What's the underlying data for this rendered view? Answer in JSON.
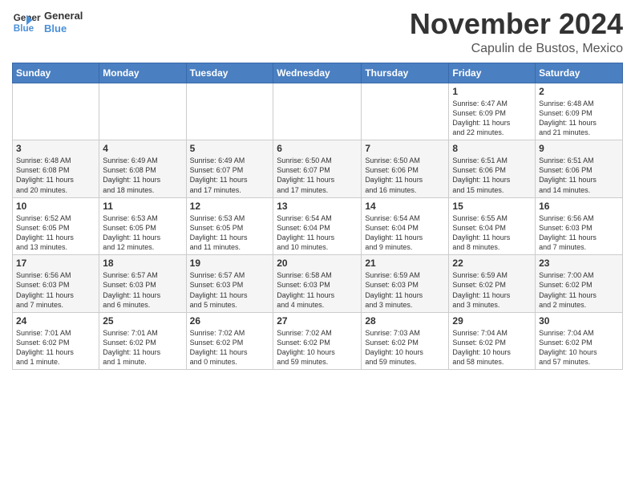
{
  "header": {
    "logo_line1": "General",
    "logo_line2": "Blue",
    "month": "November 2024",
    "location": "Capulin de Bustos, Mexico"
  },
  "weekdays": [
    "Sunday",
    "Monday",
    "Tuesday",
    "Wednesday",
    "Thursday",
    "Friday",
    "Saturday"
  ],
  "weeks": [
    [
      {
        "day": "",
        "info": ""
      },
      {
        "day": "",
        "info": ""
      },
      {
        "day": "",
        "info": ""
      },
      {
        "day": "",
        "info": ""
      },
      {
        "day": "",
        "info": ""
      },
      {
        "day": "1",
        "info": "Sunrise: 6:47 AM\nSunset: 6:09 PM\nDaylight: 11 hours\nand 22 minutes."
      },
      {
        "day": "2",
        "info": "Sunrise: 6:48 AM\nSunset: 6:09 PM\nDaylight: 11 hours\nand 21 minutes."
      }
    ],
    [
      {
        "day": "3",
        "info": "Sunrise: 6:48 AM\nSunset: 6:08 PM\nDaylight: 11 hours\nand 20 minutes."
      },
      {
        "day": "4",
        "info": "Sunrise: 6:49 AM\nSunset: 6:08 PM\nDaylight: 11 hours\nand 18 minutes."
      },
      {
        "day": "5",
        "info": "Sunrise: 6:49 AM\nSunset: 6:07 PM\nDaylight: 11 hours\nand 17 minutes."
      },
      {
        "day": "6",
        "info": "Sunrise: 6:50 AM\nSunset: 6:07 PM\nDaylight: 11 hours\nand 17 minutes."
      },
      {
        "day": "7",
        "info": "Sunrise: 6:50 AM\nSunset: 6:06 PM\nDaylight: 11 hours\nand 16 minutes."
      },
      {
        "day": "8",
        "info": "Sunrise: 6:51 AM\nSunset: 6:06 PM\nDaylight: 11 hours\nand 15 minutes."
      },
      {
        "day": "9",
        "info": "Sunrise: 6:51 AM\nSunset: 6:06 PM\nDaylight: 11 hours\nand 14 minutes."
      }
    ],
    [
      {
        "day": "10",
        "info": "Sunrise: 6:52 AM\nSunset: 6:05 PM\nDaylight: 11 hours\nand 13 minutes."
      },
      {
        "day": "11",
        "info": "Sunrise: 6:53 AM\nSunset: 6:05 PM\nDaylight: 11 hours\nand 12 minutes."
      },
      {
        "day": "12",
        "info": "Sunrise: 6:53 AM\nSunset: 6:05 PM\nDaylight: 11 hours\nand 11 minutes."
      },
      {
        "day": "13",
        "info": "Sunrise: 6:54 AM\nSunset: 6:04 PM\nDaylight: 11 hours\nand 10 minutes."
      },
      {
        "day": "14",
        "info": "Sunrise: 6:54 AM\nSunset: 6:04 PM\nDaylight: 11 hours\nand 9 minutes."
      },
      {
        "day": "15",
        "info": "Sunrise: 6:55 AM\nSunset: 6:04 PM\nDaylight: 11 hours\nand 8 minutes."
      },
      {
        "day": "16",
        "info": "Sunrise: 6:56 AM\nSunset: 6:03 PM\nDaylight: 11 hours\nand 7 minutes."
      }
    ],
    [
      {
        "day": "17",
        "info": "Sunrise: 6:56 AM\nSunset: 6:03 PM\nDaylight: 11 hours\nand 7 minutes."
      },
      {
        "day": "18",
        "info": "Sunrise: 6:57 AM\nSunset: 6:03 PM\nDaylight: 11 hours\nand 6 minutes."
      },
      {
        "day": "19",
        "info": "Sunrise: 6:57 AM\nSunset: 6:03 PM\nDaylight: 11 hours\nand 5 minutes."
      },
      {
        "day": "20",
        "info": "Sunrise: 6:58 AM\nSunset: 6:03 PM\nDaylight: 11 hours\nand 4 minutes."
      },
      {
        "day": "21",
        "info": "Sunrise: 6:59 AM\nSunset: 6:03 PM\nDaylight: 11 hours\nand 3 minutes."
      },
      {
        "day": "22",
        "info": "Sunrise: 6:59 AM\nSunset: 6:02 PM\nDaylight: 11 hours\nand 3 minutes."
      },
      {
        "day": "23",
        "info": "Sunrise: 7:00 AM\nSunset: 6:02 PM\nDaylight: 11 hours\nand 2 minutes."
      }
    ],
    [
      {
        "day": "24",
        "info": "Sunrise: 7:01 AM\nSunset: 6:02 PM\nDaylight: 11 hours\nand 1 minute."
      },
      {
        "day": "25",
        "info": "Sunrise: 7:01 AM\nSunset: 6:02 PM\nDaylight: 11 hours\nand 1 minute."
      },
      {
        "day": "26",
        "info": "Sunrise: 7:02 AM\nSunset: 6:02 PM\nDaylight: 11 hours\nand 0 minutes."
      },
      {
        "day": "27",
        "info": "Sunrise: 7:02 AM\nSunset: 6:02 PM\nDaylight: 10 hours\nand 59 minutes."
      },
      {
        "day": "28",
        "info": "Sunrise: 7:03 AM\nSunset: 6:02 PM\nDaylight: 10 hours\nand 59 minutes."
      },
      {
        "day": "29",
        "info": "Sunrise: 7:04 AM\nSunset: 6:02 PM\nDaylight: 10 hours\nand 58 minutes."
      },
      {
        "day": "30",
        "info": "Sunrise: 7:04 AM\nSunset: 6:02 PM\nDaylight: 10 hours\nand 57 minutes."
      }
    ]
  ]
}
